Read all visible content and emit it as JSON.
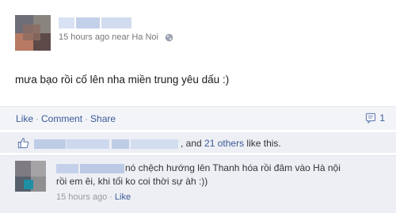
{
  "post": {
    "author_name": "",
    "timestamp": "15 hours ago near Ha Noi",
    "privacy_icon": "globe-icon",
    "message": "mưa bạo rồi cố lên nha miền trung yêu dấu :)"
  },
  "actions": {
    "like_label": "Like",
    "comment_label": "Comment",
    "share_label": "Share",
    "separator": "·",
    "comment_count": "1"
  },
  "likes": {
    "suffix_before": ", and ",
    "others_link": "21 others",
    "suffix_after": " like this."
  },
  "comment": {
    "text_line1": "nó chệch hướng lên Thanh hóa rồi đâm vào Hà nội",
    "text_line2": "rồi em êi, khi tối ko coi thời sự àh :))",
    "timestamp": "15 hours ago",
    "separator": "·",
    "like_label": "Like"
  },
  "colors": {
    "link": "#3b5998",
    "action_bar_bg": "#f2f4f8",
    "likes_bg": "#edeff4"
  }
}
